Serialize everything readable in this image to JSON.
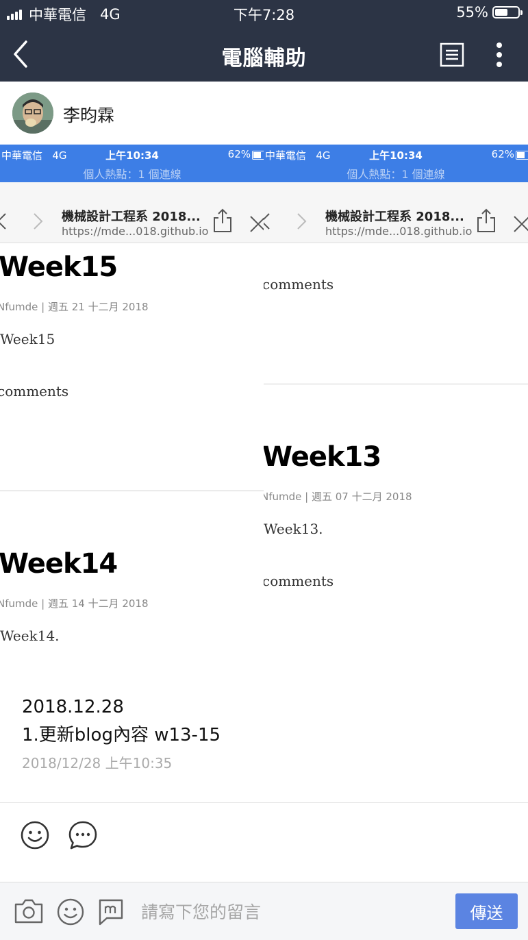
{
  "status_bar": {
    "carrier": "中華電信",
    "network": "4G",
    "time": "下午7:28",
    "battery": "55%",
    "battery_level": 0.55
  },
  "nav": {
    "title": "電腦輔助",
    "icons": [
      "back-icon",
      "notes-icon",
      "more-icon"
    ]
  },
  "author": {
    "name": "李昀霖"
  },
  "screenshots": [
    {
      "status": {
        "carrier": "中華電信",
        "network": "4G",
        "time": "上午10:34",
        "battery": "62%",
        "hotspot": "個人熱點：1 個連線"
      },
      "browser": {
        "title": "機械設計工程系 2018...",
        "url": "https://mde...018.github.io"
      },
      "posts": [
        {
          "heading": "Week15",
          "meta": "Nfumde | 週五 21 十二月 2018",
          "body": "Week15",
          "comments": "comments"
        },
        {
          "heading": "Week14",
          "meta": "Nfumde | 週五 14 十二月 2018",
          "body": "Week14."
        }
      ]
    },
    {
      "status": {
        "carrier": "中華電信",
        "network": "4G",
        "time": "上午10:34",
        "battery": "62%",
        "hotspot": "個人熱點：1 個連線"
      },
      "browser": {
        "title": "機械設計工程系 2018...",
        "url": "https://mde...018.github.io"
      },
      "top_comments": "comments",
      "posts": [
        {
          "heading": "Week13",
          "meta": "Nfumde | 週五 07 十二月 2018",
          "body": "Week13.",
          "comments": "comments"
        }
      ]
    }
  ],
  "post": {
    "line1": "2018.12.28",
    "line2": "1.更新blog內容 w13-15",
    "timestamp": "2018/12/28 上午10:35"
  },
  "actions": {
    "icons": [
      "smiley-icon",
      "comment-icon"
    ]
  },
  "composer": {
    "placeholder": "請寫下您的留言",
    "send_label": "傳送"
  }
}
